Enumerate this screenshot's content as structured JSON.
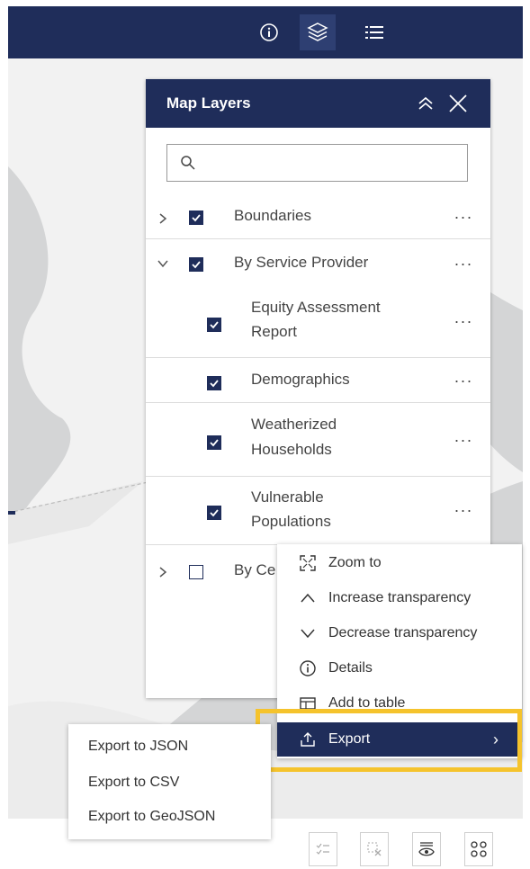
{
  "toolbar": {
    "info_label": "ⓘ",
    "list_label": "☰"
  },
  "panel": {
    "title": "Map Layers",
    "search_placeholder": "",
    "layers": [
      {
        "label": "Boundaries",
        "checked": true,
        "expanded": false
      },
      {
        "label": "By Service Provider",
        "checked": true,
        "expanded": true
      },
      {
        "label_line1": "Equity Assessment",
        "label_line2": "Report",
        "checked": true
      },
      {
        "label": "Demographics",
        "checked": true
      },
      {
        "label_line1": "Weatherized",
        "label_line2": "Households",
        "checked": true
      },
      {
        "label_line1": "Vulnerable",
        "label_line2": "Populations",
        "checked": true
      },
      {
        "label": "By Ce",
        "checked": false,
        "expanded": false
      }
    ],
    "more_label": "···"
  },
  "context_menu": {
    "items": [
      {
        "label": "Zoom to",
        "icon": "zoom-to-icon"
      },
      {
        "label": "Increase transparency",
        "icon": "chevron-up-icon"
      },
      {
        "label": "Decrease transparency",
        "icon": "chevron-down-icon"
      },
      {
        "label": "Details",
        "icon": "info-icon"
      },
      {
        "label": "Add to table",
        "icon": "table-icon"
      },
      {
        "label": "Export",
        "icon": "export-icon",
        "active": true
      }
    ],
    "export_arrow": "›"
  },
  "export_submenu": {
    "items": [
      "Export to JSON",
      "Export to CSV",
      "Export to GeoJSON"
    ]
  },
  "colors": {
    "navy": "#1f2d5a",
    "highlight": "#f5c32c",
    "map_gray": "#d4d5d6",
    "land_white": "#f2f2f2"
  }
}
